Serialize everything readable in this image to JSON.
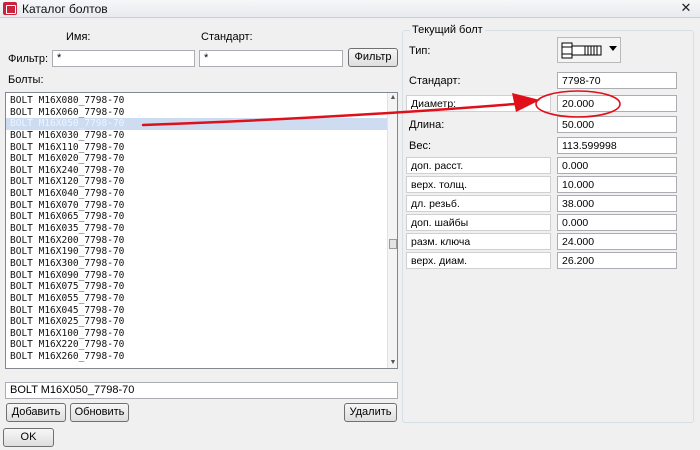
{
  "window": {
    "title": "Каталог болтов",
    "close_icon": "close-icon"
  },
  "filter": {
    "name_header": "Имя:",
    "standard_header": "Стандарт:",
    "label": "Фильтр:",
    "name_value": "*",
    "standard_value": "*",
    "button": "Фильтр"
  },
  "bolts": {
    "label": "Болты:",
    "selected_index": 2,
    "items": [
      "BOLT M16X080_7798-70",
      "BOLT M16X060_7798-70",
      "BOLT M16X050_7798-70",
      "BOLT M16X030_7798-70",
      "BOLT M16X110_7798-70",
      "BOLT M16X020_7798-70",
      "BOLT M16X240_7798-70",
      "BOLT M16X120_7798-70",
      "BOLT M16X040_7798-70",
      "BOLT M16X070_7798-70",
      "BOLT M16X065_7798-70",
      "BOLT M16X035_7798-70",
      "BOLT M16X200_7798-70",
      "BOLT M16X190_7798-70",
      "BOLT M16X300_7798-70",
      "BOLT M16X090_7798-70",
      "BOLT M16X075_7798-70",
      "BOLT M16X055_7798-70",
      "BOLT M16X045_7798-70",
      "BOLT M16X025_7798-70",
      "BOLT M16X100_7798-70",
      "BOLT M16X220_7798-70",
      "BOLT M16X260_7798-70"
    ],
    "current_value": "BOLT M16X050_7798-70"
  },
  "buttons": {
    "add": "Добавить",
    "update": "Обновить",
    "delete": "Удалить",
    "ok": "OK"
  },
  "current_bolt": {
    "title": "Текущий болт",
    "type_label": "Тип:",
    "type_icon": "bolt-icon",
    "standard_label": "Стандарт:",
    "standard_value": "7798-70",
    "diameter_label": "Диаметр:",
    "diameter_value": "20.000",
    "length_label": "Длина:",
    "length_value": "50.000",
    "weight_label": "Вес:",
    "weight_value": "113.599998",
    "props": [
      {
        "label": "доп. расст.",
        "value": "0.000"
      },
      {
        "label": "верх. толщ.",
        "value": "10.000"
      },
      {
        "label": "дл. резьб.",
        "value": "38.000"
      },
      {
        "label": "доп. шайбы",
        "value": "0.000"
      },
      {
        "label": "разм. ключа",
        "value": "24.000"
      },
      {
        "label": "верх. диам.",
        "value": "26.200"
      }
    ]
  },
  "annotation": {
    "color": "#e0101a"
  }
}
